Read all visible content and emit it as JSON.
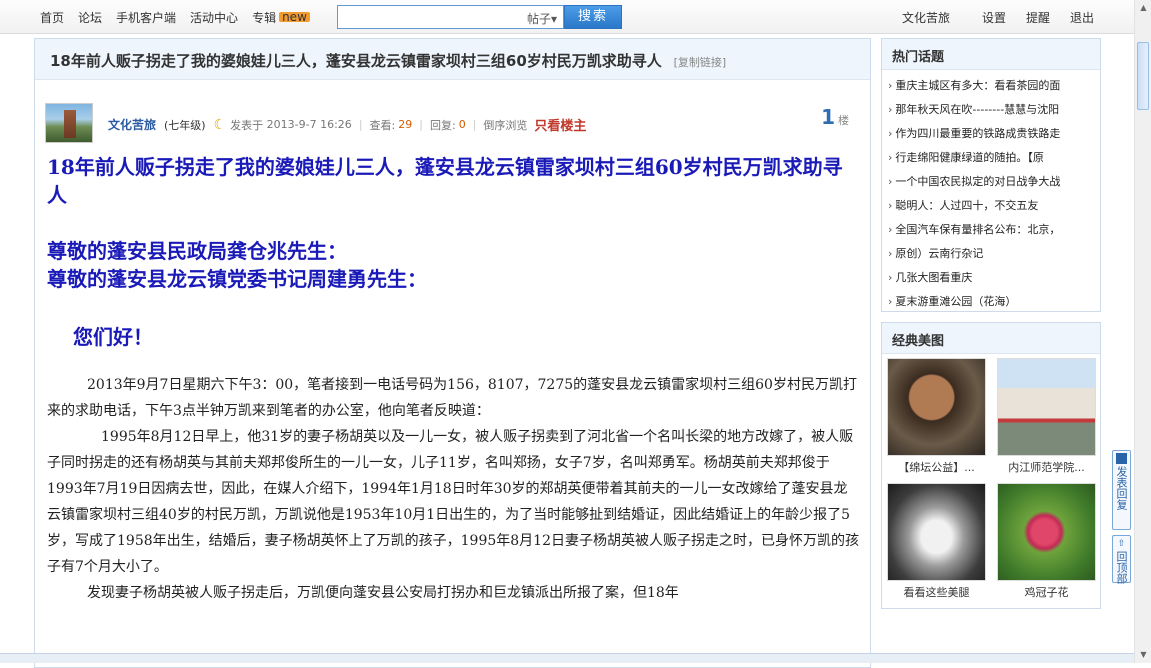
{
  "topnav": {
    "items": [
      "首页",
      "论坛",
      "手机客户端",
      "活动中心",
      "专辑"
    ],
    "new_badge": "new",
    "search": {
      "placeholder": "",
      "scope": "帖子",
      "button": "搜索"
    },
    "right": {
      "user": "文化苦旅",
      "settings": "设置",
      "remind": "提醒",
      "logout": "退出"
    }
  },
  "post": {
    "title": "18年前人贩子拐走了我的婆娘娃儿三人，蓬安县龙云镇雷家坝村三组60岁村民万凯求助寻人",
    "copy_link": "[复制链接]",
    "author": "文化苦旅",
    "level": "(七年级)",
    "posted_label": "发表于",
    "posted_time": "2013-9-7 16:26",
    "views_label": "查看:",
    "views": "29",
    "replies_label": "回复:",
    "replies": "0",
    "reverse_label": "倒序浏览",
    "only_op": "只看楼主",
    "floor": "1",
    "floor_unit": "楼",
    "body_title": "18年前人贩子拐走了我的婆娘娃儿三人，蓬安县龙云镇雷家坝村三组60岁村民万凯求助寻人",
    "greet1": "尊敬的蓬安县民政局龚仓兆先生：",
    "greet2": "尊敬的蓬安县龙云镇党委书记周建勇先生：",
    "hello": "您们好！",
    "para1": "2013年9月7日星期六下午3：00，笔者接到一电话号码为156，8107，7275的蓬安县龙云镇雷家坝村三组60岁村民万凯打来的求助电话，下午3点半钟万凯来到笔者的办公室，他向笔者反映道：",
    "para2": "1995年8月12日早上，他31岁的妻子杨胡英以及一儿一女，被人贩子拐卖到了河北省一个名叫长梁的地方改嫁了，被人贩子同时拐走的还有杨胡英与其前夫郑邦俊所生的一儿一女，儿子11岁，名叫郑扬，女子7岁，名叫郑勇军。杨胡英前夫郑邦俊于1993年7月19日因病去世，因此，在媒人介绍下，1994年1月18日时年30岁的郑胡英便带着其前夫的一儿一女改嫁给了蓬安县龙云镇雷家坝村三组40岁的村民万凯，万凯说他是1953年10月1日出生的，为了当时能够扯到结婚证，因此结婚证上的年龄少报了5岁，写成了1958年出生，结婚后，妻子杨胡英怀上了万凯的孩子，1995年8月12日妻子杨胡英被人贩子拐走之时，已身怀万凯的孩子有7个月大小了。",
    "para3": "发现妻子杨胡英被人贩子拐走后，万凯便向蓬安县公安局打拐办和巨龙镇派出所报了案，但18年"
  },
  "sidebar": {
    "hot_title": "热门话题",
    "hot_items": [
      "重庆主城区有多大：看看茶园的面",
      "那年秋天风在吹--------慧慧与沈阳",
      "作为四川最重要的铁路成贵铁路走",
      "行走绵阳健康绿道的随拍。【原",
      "一个中国农民拟定的对日战争大战",
      "聪明人：人过四十，不交五友",
      "全国汽车保有量排名公布：北京，",
      "原创）云南行杂记",
      "几张大图看重庆",
      "夏末游重滩公园（花海）"
    ],
    "pics_title": "经典美图",
    "pics": [
      {
        "caption": "【绵坛公益】..."
      },
      {
        "caption": "内江师范学院..."
      },
      {
        "caption": "看看这些美腿"
      },
      {
        "caption": "鸡冠子花"
      }
    ]
  },
  "float": {
    "reply": "发表回复",
    "top": "回顶部"
  }
}
